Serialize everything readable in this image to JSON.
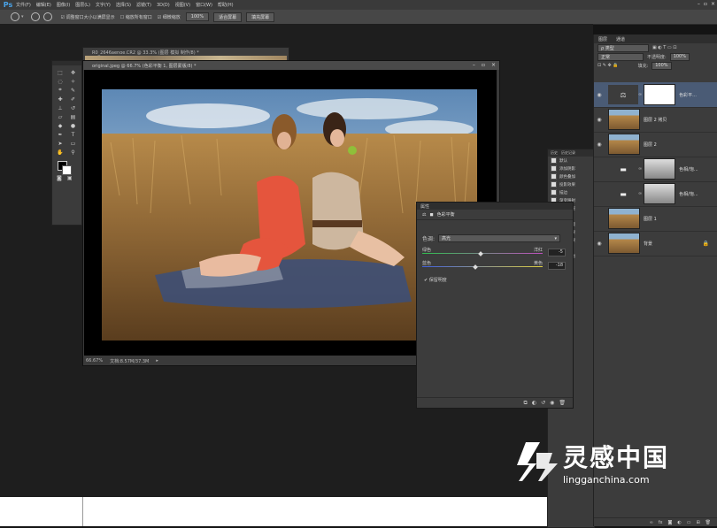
{
  "app": {
    "logo": "Ps"
  },
  "menubar": {
    "items": [
      "文件(F)",
      "编辑(E)",
      "图像(I)",
      "图层(L)",
      "文字(Y)",
      "选择(S)",
      "滤镜(T)",
      "3D(D)",
      "视图(V)",
      "窗口(W)",
      "帮助(H)"
    ]
  },
  "options_bar": {
    "resize_windows": "调整窗口大小以满屏显示",
    "zoom_all": "缩放所有窗口",
    "scrubby_zoom": "细微缩放",
    "btn_100": "100%",
    "btn_fit": "适合屏幕",
    "btn_fill": "填充屏幕"
  },
  "back_document": {
    "title": "R0_2646aenoe.CR2 @ 33.3% (图层 模拟 制作/8) *"
  },
  "document": {
    "title": "original.jpeg @ 66.7% (色彩平衡 1, 图层蒙版/8) *",
    "status_zoom": "66.67%",
    "status_doc": "文档:8.57M/37.3M"
  },
  "properties": {
    "tab": "属性",
    "panel_name": "色彩平衡",
    "tone_label": "色调:",
    "tone_value": "高光",
    "slider1_left": "绿色",
    "slider1_right": "洋红",
    "slider1_value": "-5",
    "slider2_left": "蓝色",
    "slider2_right": "黄色",
    "slider2_value": "-18",
    "preserve": "保留明度"
  },
  "mid_panel": {
    "tabs": [
      "历史",
      "历史记录"
    ],
    "items": [
      "默认",
      "添加阴影",
      "颜色叠加",
      "投影效果",
      "描边",
      "渐变映射",
      "当前图层",
      "自定义",
      "添加蒙版",
      "暗角效果",
      "最终效果",
      "曝光度",
      "色彩平衡",
      "调整",
      "模糊",
      "图层 1",
      "动作 1",
      "Pixel"
    ]
  },
  "layers": {
    "tabs": [
      "图层",
      "通道"
    ],
    "kind": "ρ 类型",
    "blend": "正常",
    "opacity_label": "不透明度:",
    "opacity": "100%",
    "fill_label": "填充:",
    "fill": "100%",
    "items": [
      {
        "name": "色彩平...",
        "type": "adjustment",
        "active": true
      },
      {
        "name": "图层 2 拷贝",
        "type": "photo"
      },
      {
        "name": "图层 2",
        "type": "photo"
      },
      {
        "name": "色相/饱...",
        "type": "bw"
      },
      {
        "name": "色相/饱...",
        "type": "bw"
      },
      {
        "name": "图层 1",
        "type": "photo"
      },
      {
        "name": "背景",
        "type": "photo"
      }
    ]
  },
  "watermark": {
    "main": "灵感中国",
    "sub": "lingganchina.com"
  }
}
